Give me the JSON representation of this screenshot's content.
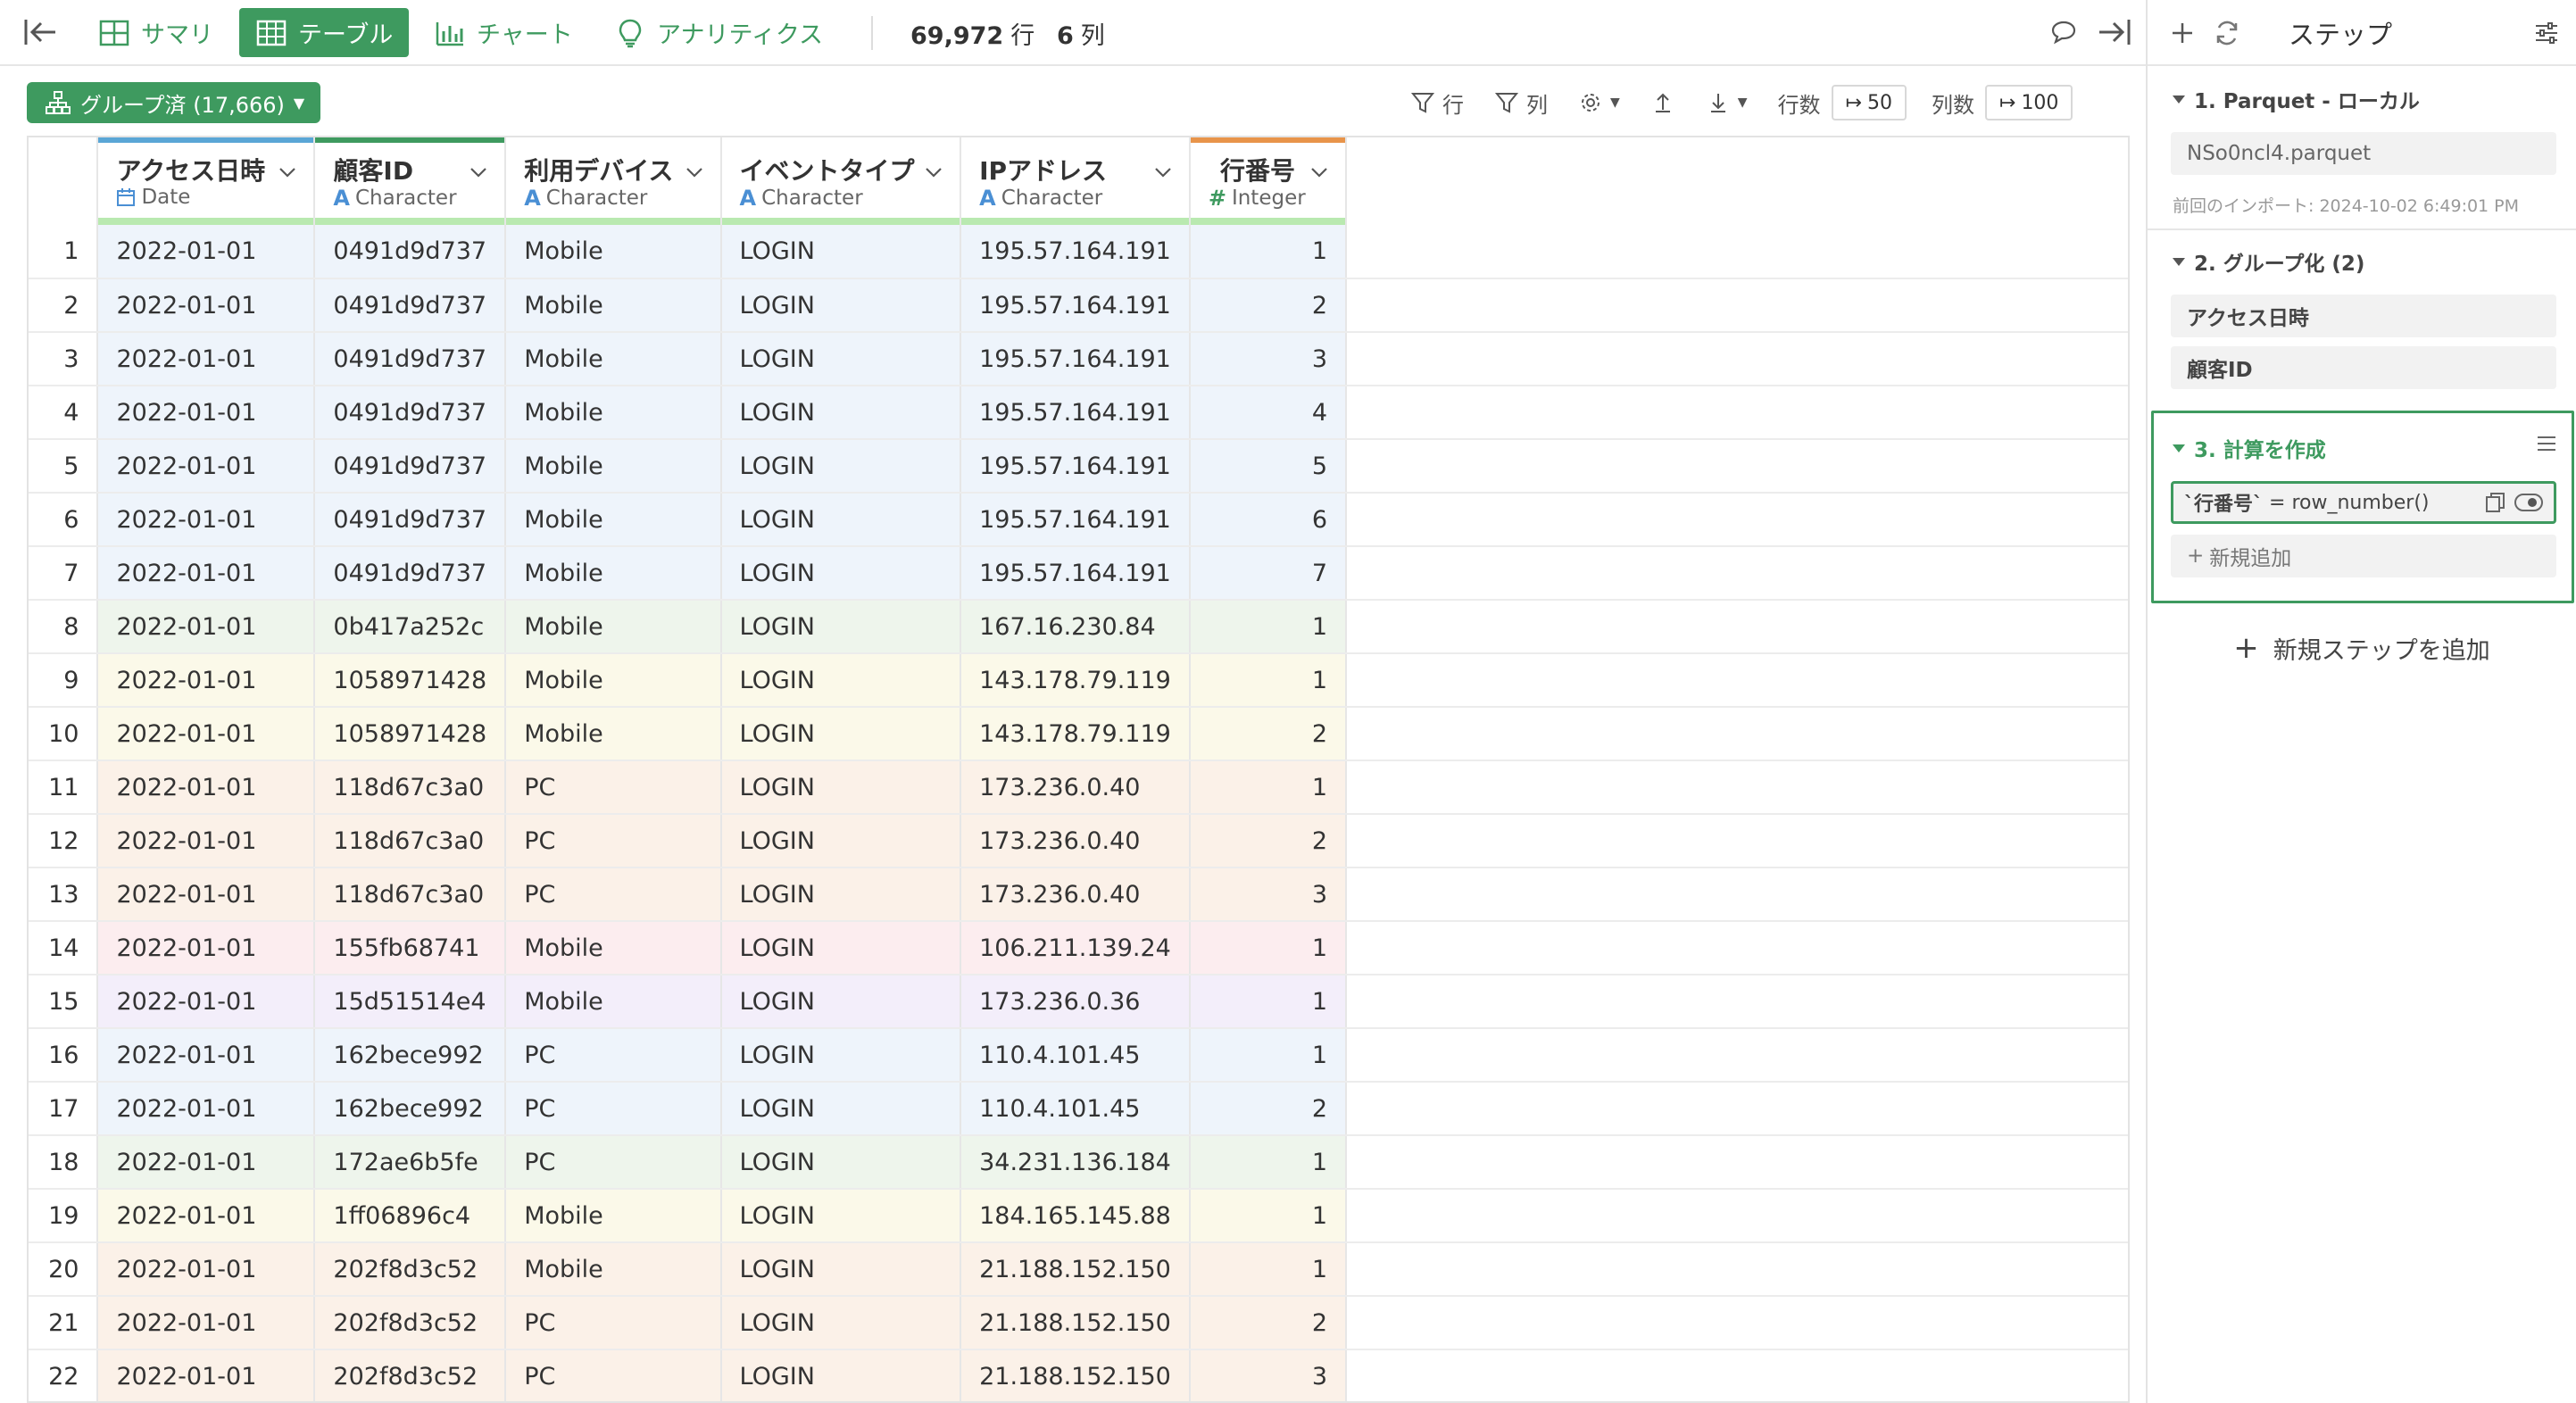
{
  "toolbar": {
    "tabs": [
      {
        "label": "サマリ",
        "icon": "grid-icon"
      },
      {
        "label": "テーブル",
        "icon": "table-icon",
        "active": true
      },
      {
        "label": "チャート",
        "icon": "bar-chart-icon"
      },
      {
        "label": "アナリティクス",
        "icon": "lightbulb-icon"
      }
    ],
    "rows_value": "69,972",
    "rows_unit": "行",
    "cols_value": "6",
    "cols_unit": "列"
  },
  "subtoolbar": {
    "group_label": "グループ済 (17,666)",
    "filter_rows": "行",
    "filter_cols": "列",
    "rows_label": "行数",
    "rows_limit": "50",
    "cols_label": "列数",
    "cols_limit": "100"
  },
  "columns": [
    {
      "name": "アクセス日時",
      "type": "Date",
      "type_icon": "calendar-icon",
      "accent": "#5aa6d6"
    },
    {
      "name": "顧客ID",
      "type": "Character",
      "type_icon": "A",
      "accent": "#3e9a5f"
    },
    {
      "name": "利用デバイス",
      "type": "Character",
      "type_icon": "A",
      "accent": ""
    },
    {
      "name": "イベントタイプ",
      "type": "Character",
      "type_icon": "A",
      "accent": ""
    },
    {
      "name": "IPアドレス",
      "type": "Character",
      "type_icon": "A",
      "accent": ""
    },
    {
      "name": "行番号",
      "type": "Integer",
      "type_icon": "#",
      "accent": "#e8944a"
    }
  ],
  "rows": [
    {
      "n": "1",
      "date": "2022-01-01",
      "id": "0491d9d737",
      "device": "Mobile",
      "event": "LOGIN",
      "ip": "195.57.164.191",
      "rn": "1"
    },
    {
      "n": "2",
      "date": "2022-01-01",
      "id": "0491d9d737",
      "device": "Mobile",
      "event": "LOGIN",
      "ip": "195.57.164.191",
      "rn": "2"
    },
    {
      "n": "3",
      "date": "2022-01-01",
      "id": "0491d9d737",
      "device": "Mobile",
      "event": "LOGIN",
      "ip": "195.57.164.191",
      "rn": "3"
    },
    {
      "n": "4",
      "date": "2022-01-01",
      "id": "0491d9d737",
      "device": "Mobile",
      "event": "LOGIN",
      "ip": "195.57.164.191",
      "rn": "4"
    },
    {
      "n": "5",
      "date": "2022-01-01",
      "id": "0491d9d737",
      "device": "Mobile",
      "event": "LOGIN",
      "ip": "195.57.164.191",
      "rn": "5"
    },
    {
      "n": "6",
      "date": "2022-01-01",
      "id": "0491d9d737",
      "device": "Mobile",
      "event": "LOGIN",
      "ip": "195.57.164.191",
      "rn": "6"
    },
    {
      "n": "7",
      "date": "2022-01-01",
      "id": "0491d9d737",
      "device": "Mobile",
      "event": "LOGIN",
      "ip": "195.57.164.191",
      "rn": "7"
    },
    {
      "n": "8",
      "date": "2022-01-01",
      "id": "0b417a252c",
      "device": "Mobile",
      "event": "LOGIN",
      "ip": "167.16.230.84",
      "rn": "1"
    },
    {
      "n": "9",
      "date": "2022-01-01",
      "id": "1058971428",
      "device": "Mobile",
      "event": "LOGIN",
      "ip": "143.178.79.119",
      "rn": "1"
    },
    {
      "n": "10",
      "date": "2022-01-01",
      "id": "1058971428",
      "device": "Mobile",
      "event": "LOGIN",
      "ip": "143.178.79.119",
      "rn": "2"
    },
    {
      "n": "11",
      "date": "2022-01-01",
      "id": "118d67c3a0",
      "device": "PC",
      "event": "LOGIN",
      "ip": "173.236.0.40",
      "rn": "1"
    },
    {
      "n": "12",
      "date": "2022-01-01",
      "id": "118d67c3a0",
      "device": "PC",
      "event": "LOGIN",
      "ip": "173.236.0.40",
      "rn": "2"
    },
    {
      "n": "13",
      "date": "2022-01-01",
      "id": "118d67c3a0",
      "device": "PC",
      "event": "LOGIN",
      "ip": "173.236.0.40",
      "rn": "3"
    },
    {
      "n": "14",
      "date": "2022-01-01",
      "id": "155fb68741",
      "device": "Mobile",
      "event": "LOGIN",
      "ip": "106.211.139.24",
      "rn": "1"
    },
    {
      "n": "15",
      "date": "2022-01-01",
      "id": "15d51514e4",
      "device": "Mobile",
      "event": "LOGIN",
      "ip": "173.236.0.36",
      "rn": "1"
    },
    {
      "n": "16",
      "date": "2022-01-01",
      "id": "162bece992",
      "device": "PC",
      "event": "LOGIN",
      "ip": "110.4.101.45",
      "rn": "1"
    },
    {
      "n": "17",
      "date": "2022-01-01",
      "id": "162bece992",
      "device": "PC",
      "event": "LOGIN",
      "ip": "110.4.101.45",
      "rn": "2"
    },
    {
      "n": "18",
      "date": "2022-01-01",
      "id": "172ae6b5fe",
      "device": "PC",
      "event": "LOGIN",
      "ip": "34.231.136.184",
      "rn": "1"
    },
    {
      "n": "19",
      "date": "2022-01-01",
      "id": "1ff06896c4",
      "device": "Mobile",
      "event": "LOGIN",
      "ip": "184.165.145.88",
      "rn": "1"
    },
    {
      "n": "20",
      "date": "2022-01-01",
      "id": "202f8d3c52",
      "device": "Mobile",
      "event": "LOGIN",
      "ip": "21.188.152.150",
      "rn": "1"
    },
    {
      "n": "21",
      "date": "2022-01-01",
      "id": "202f8d3c52",
      "device": "PC",
      "event": "LOGIN",
      "ip": "21.188.152.150",
      "rn": "2"
    },
    {
      "n": "22",
      "date": "2022-01-01",
      "id": "202f8d3c52",
      "device": "PC",
      "event": "LOGIN",
      "ip": "21.188.152.150",
      "rn": "3"
    }
  ],
  "group_colors": [
    "#eef4fb",
    "#eef4fb",
    "#eef4fb",
    "#eef4fb",
    "#eef4fb",
    "#eef4fb",
    "#eef4fb",
    "#eef5ec",
    "#fbf9e9",
    "#fbf9e9",
    "#fbf1e8",
    "#fbf1e8",
    "#fbf1e8",
    "#fcedef",
    "#f3eefa",
    "#eef4fb",
    "#eef4fb",
    "#eef5ec",
    "#fbf9e9",
    "#fbf1e8",
    "#fbf1e8",
    "#fbf1e8"
  ],
  "panel": {
    "title": "ステップ",
    "step1_title": "1. Parquet - ローカル",
    "step1_file": "NSo0ncl4.parquet",
    "step1_note": "前回のインポート: 2024-10-02 6:49:01 PM",
    "step2_title": "2. グループ化 (2)",
    "step2_items": [
      "アクセス日時",
      "顧客ID"
    ],
    "step3_title": "3. 計算を作成",
    "step3_formula_col": "`行番号`",
    "step3_formula_expr": "= row_number()",
    "step3_add": "新規追加",
    "add_step": "新規ステップを追加"
  },
  "accent_color": "#3e9a5f"
}
